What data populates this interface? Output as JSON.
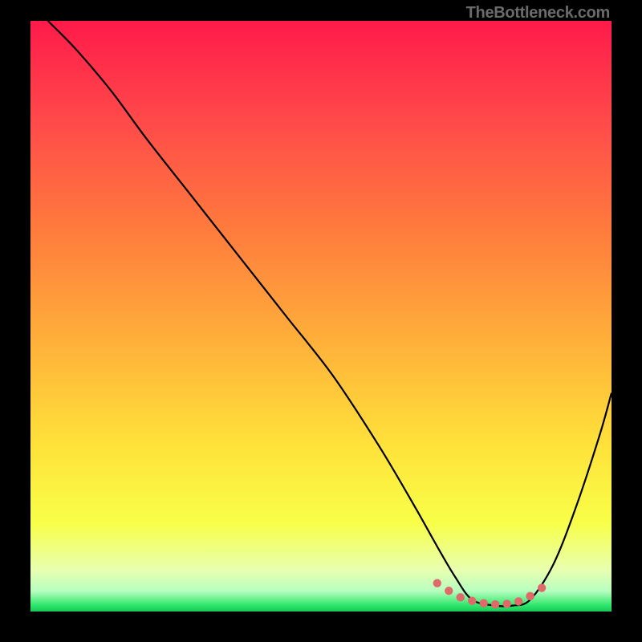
{
  "watermark": "TheBottleneck.com",
  "chart_data": {
    "type": "line",
    "title": "",
    "xlabel": "",
    "ylabel": "",
    "xlim": [
      0,
      100
    ],
    "ylim": [
      0,
      100
    ],
    "gradient_stops": [
      {
        "offset": 0,
        "color": "#ff1a4a"
      },
      {
        "offset": 0.17,
        "color": "#ff4a4a"
      },
      {
        "offset": 0.35,
        "color": "#ff7a3d"
      },
      {
        "offset": 0.55,
        "color": "#ffb23a"
      },
      {
        "offset": 0.72,
        "color": "#ffe23a"
      },
      {
        "offset": 0.85,
        "color": "#f8ff48"
      },
      {
        "offset": 0.93,
        "color": "#e8ffb0"
      },
      {
        "offset": 0.965,
        "color": "#b8ffc0"
      },
      {
        "offset": 0.99,
        "color": "#2ce66a"
      },
      {
        "offset": 1.0,
        "color": "#18c757"
      }
    ],
    "series": [
      {
        "name": "bottleneck-curve",
        "color": "#000000",
        "x": [
          3,
          8,
          14,
          20,
          28,
          36,
          44,
          52,
          60,
          66,
          70,
          73,
          76,
          80,
          83,
          86,
          90,
          94,
          98,
          100
        ],
        "values": [
          100,
          95,
          88,
          80,
          70,
          60,
          50,
          40,
          28,
          18,
          11,
          6,
          2,
          1,
          1,
          2,
          8,
          18,
          30,
          37
        ]
      }
    ],
    "markers": {
      "name": "bottleneck-sweet-spot",
      "color": "#e06a6a",
      "x": [
        70,
        72,
        74,
        76,
        78,
        80,
        82,
        84,
        86,
        88
      ],
      "values": [
        4.8,
        3.5,
        2.4,
        1.8,
        1.4,
        1.2,
        1.3,
        1.7,
        2.6,
        4.0
      ]
    }
  }
}
